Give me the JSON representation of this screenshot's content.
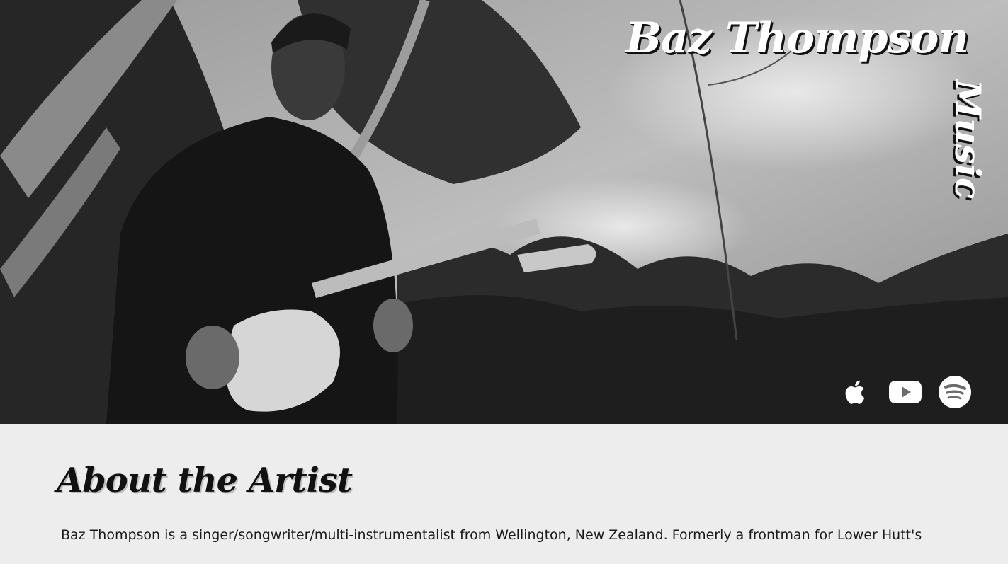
{
  "hero": {
    "title": "Baz Thompson",
    "subtitle": "Music",
    "image_alt": "Black and white photo of Baz Thompson playing an electric guitar among trees"
  },
  "social": [
    {
      "name": "apple-music",
      "icon": "apple-icon"
    },
    {
      "name": "youtube",
      "icon": "youtube-icon"
    },
    {
      "name": "spotify",
      "icon": "spotify-icon"
    }
  ],
  "about": {
    "heading": "About the Artist",
    "body": "Baz Thompson is a singer/songwriter/multi-instrumentalist from Wellington, New Zealand. Formerly a frontman for Lower Hutt's"
  },
  "colors": {
    "page_background": "#ededed",
    "title_text": "#ffffff",
    "heading_text": "#111111"
  }
}
